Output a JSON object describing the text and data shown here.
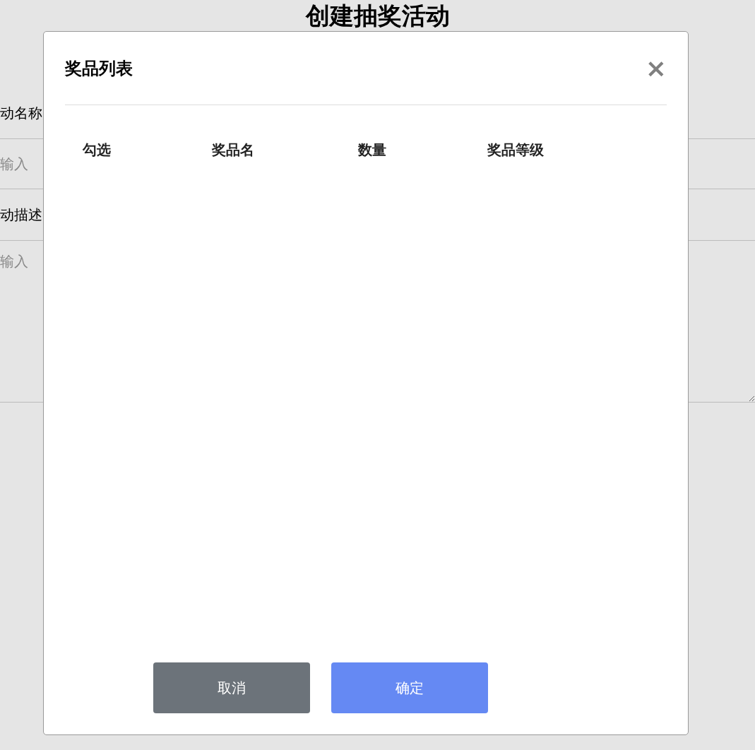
{
  "page": {
    "title": "创建抽奖活动",
    "fields": [
      {
        "label": "动名称",
        "placeholder": "输入",
        "kind": "input"
      },
      {
        "label": "动描述",
        "placeholder": "输入",
        "kind": "textarea"
      }
    ]
  },
  "dialog": {
    "title": "奖品列表",
    "close": "×",
    "table": {
      "columns": [
        "勾选",
        "奖品名",
        "数量",
        "奖品等级"
      ]
    },
    "buttons": [
      {
        "label": "取消",
        "kind": "secondary"
      },
      {
        "label": "确定",
        "kind": "primary"
      }
    ]
  }
}
